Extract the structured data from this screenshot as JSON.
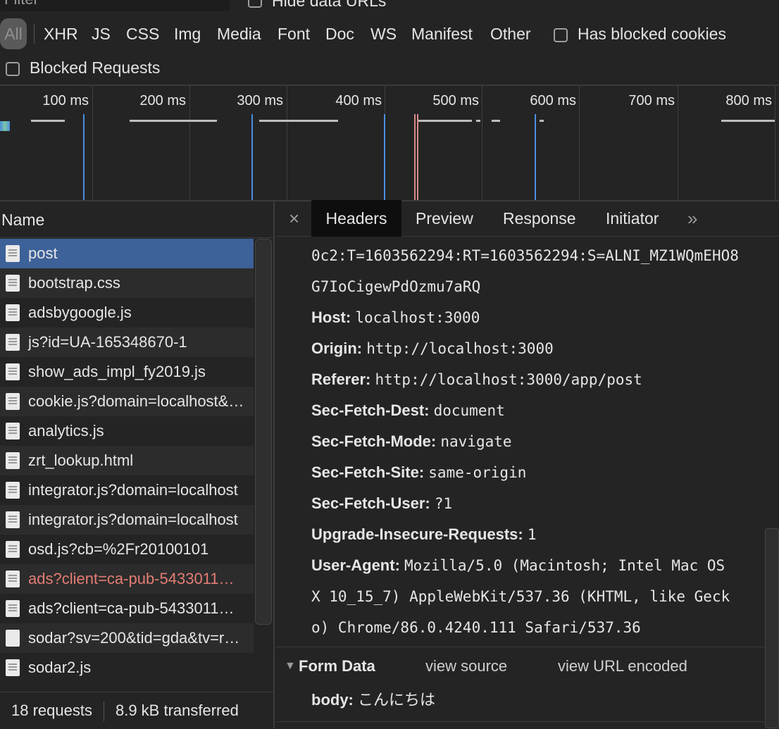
{
  "filter": {
    "placeholder": "Filter",
    "hide_data_urls_label": "Hide data URLs"
  },
  "type_filters": [
    "All",
    "XHR",
    "JS",
    "CSS",
    "Img",
    "Media",
    "Font",
    "Doc",
    "WS",
    "Manifest",
    "Other"
  ],
  "has_blocked_cookies_label": "Has blocked cookies",
  "blocked_requests_label": "Blocked Requests",
  "overview": {
    "ticks": [
      "100 ms",
      "200 ms",
      "300 ms",
      "400 ms",
      "500 ms",
      "600 ms",
      "700 ms",
      "800 ms"
    ]
  },
  "name_column_header": "Name",
  "requests": [
    {
      "name": "post",
      "selected": true,
      "error": false
    },
    {
      "name": "bootstrap.css",
      "selected": false,
      "error": false
    },
    {
      "name": "adsbygoogle.js",
      "selected": false,
      "error": false
    },
    {
      "name": "js?id=UA-165348670-1",
      "selected": false,
      "error": false
    },
    {
      "name": "show_ads_impl_fy2019.js",
      "selected": false,
      "error": false
    },
    {
      "name": "cookie.js?domain=localhost&…",
      "selected": false,
      "error": false
    },
    {
      "name": "analytics.js",
      "selected": false,
      "error": false
    },
    {
      "name": "zrt_lookup.html",
      "selected": false,
      "error": false
    },
    {
      "name": "integrator.js?domain=localhost",
      "selected": false,
      "error": false
    },
    {
      "name": "integrator.js?domain=localhost",
      "selected": false,
      "error": false
    },
    {
      "name": "osd.js?cb=%2Fr20100101",
      "selected": false,
      "error": false
    },
    {
      "name": "ads?client=ca-pub-5433011…",
      "selected": false,
      "error": true
    },
    {
      "name": "ads?client=ca-pub-5433011…",
      "selected": false,
      "error": false
    },
    {
      "name": "sodar?sv=200&tid=gda&tv=r…",
      "selected": false,
      "error": false
    },
    {
      "name": "sodar2.js",
      "selected": false,
      "error": false
    }
  ],
  "status_bar": {
    "requests": "18 requests",
    "transferred": "8.9 kB transferred"
  },
  "tabs": {
    "close": "×",
    "headers": "Headers",
    "preview": "Preview",
    "response": "Response",
    "initiator": "Initiator",
    "more": "»"
  },
  "header_lines": [
    {
      "key": "",
      "value": "0c2:T=1603562294:RT=1603562294:S=ALNI_MZ1WQmEHO8"
    },
    {
      "key": "",
      "value": "G7IoCigewPdOzmu7aRQ"
    },
    {
      "key": "Host:",
      "value": "localhost:3000"
    },
    {
      "key": "Origin:",
      "value": "http://localhost:3000"
    },
    {
      "key": "Referer:",
      "value": "http://localhost:3000/app/post"
    },
    {
      "key": "Sec-Fetch-Dest:",
      "value": "document"
    },
    {
      "key": "Sec-Fetch-Mode:",
      "value": "navigate"
    },
    {
      "key": "Sec-Fetch-Site:",
      "value": "same-origin"
    },
    {
      "key": "Sec-Fetch-User:",
      "value": "?1"
    },
    {
      "key": "Upgrade-Insecure-Requests:",
      "value": "1"
    },
    {
      "key": "User-Agent:",
      "value": "Mozilla/5.0 (Macintosh; Intel Mac OS"
    },
    {
      "key": "",
      "value": "X 10_15_7) AppleWebKit/537.36 (KHTML, like Geck"
    },
    {
      "key": "",
      "value": "o) Chrome/86.0.4240.111 Safari/537.36"
    }
  ],
  "form_data": {
    "title": "Form Data",
    "view_source": "view source",
    "view_url_encoded": "view URL encoded",
    "body_key": "body:",
    "body_value": "こんにちは"
  },
  "colors": {
    "selected_row": "#3d6199",
    "error_text": "#e37d74",
    "timeline_blue": "#4a8fe0",
    "timeline_red": "#d98b8b"
  }
}
